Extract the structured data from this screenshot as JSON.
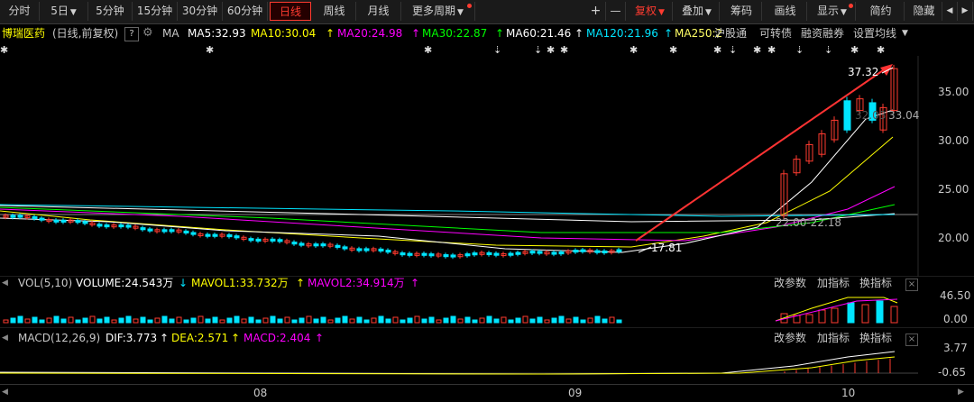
{
  "toolbar": {
    "periods": [
      "分时",
      "5日",
      "5分钟",
      "15分钟",
      "30分钟",
      "60分钟",
      "日线",
      "周线",
      "月线",
      "更多周期"
    ],
    "plus": "+",
    "minus": "—",
    "fuquan": "复权",
    "diejia": "叠加",
    "chouma": "筹码",
    "huaxian": "画线",
    "xianshi": "显示",
    "jianyue": "简约",
    "yincang": "隐藏",
    "nav_left": "◀",
    "nav_right": "▶"
  },
  "info": {
    "stock_name": "博瑞医药",
    "adjust": "(日线,前复权)",
    "help": "?",
    "ma_label": "MA",
    "ma5": "MA5:32.93",
    "ma10": "MA10:30.04",
    "ma20": "MA20:24.98",
    "ma30": "MA30:22.87",
    "ma60": "MA60:21.46",
    "ma120": "MA120:21.96",
    "ma250": "MA250:2",
    "hugutong": "沪股通",
    "kezhuanzhai": "可转债",
    "rongzi": "融资融券",
    "setma": "设置均线"
  },
  "colors": {
    "ma5": "#ffffff",
    "ma10": "#ffff00",
    "ma20": "#ff00ff",
    "ma30": "#00ff00",
    "ma60": "#ffffff",
    "ma120": "#00e5ff",
    "ma250": "#ffff66",
    "up": "#ff3b30",
    "down": "#00e5ff"
  },
  "price_axis": [
    "35.00",
    "30.00",
    "25.00",
    "20.00"
  ],
  "annotations": {
    "high": "37.32",
    "low": "17.81",
    "zone": "22.00-22.18",
    "last": "33.04",
    "mid": "32.03"
  },
  "vol": {
    "label": "VOL(5,10)",
    "volume": "VOLUME:24.543万",
    "mavol1": "MAVOL1:33.732万",
    "mavol2": "MAVOL2:34.914万",
    "gaicanshu": "改参数",
    "jiazhibiao": "加指标",
    "huanzhibiao": "换指标",
    "axis_top": "46.50",
    "axis_bottom": "0.00"
  },
  "macd": {
    "label": "MACD(12,26,9)",
    "dif": "DIF:3.773",
    "dea": "DEA:2.571",
    "macd": "MACD:2.404",
    "gaicanshu": "改参数",
    "jiazhibiao": "加指标",
    "huanzhibiao": "换指标",
    "axis_top": "3.77",
    "axis_bottom": "-0.65"
  },
  "xaxis": [
    "08",
    "09",
    "10"
  ]
}
